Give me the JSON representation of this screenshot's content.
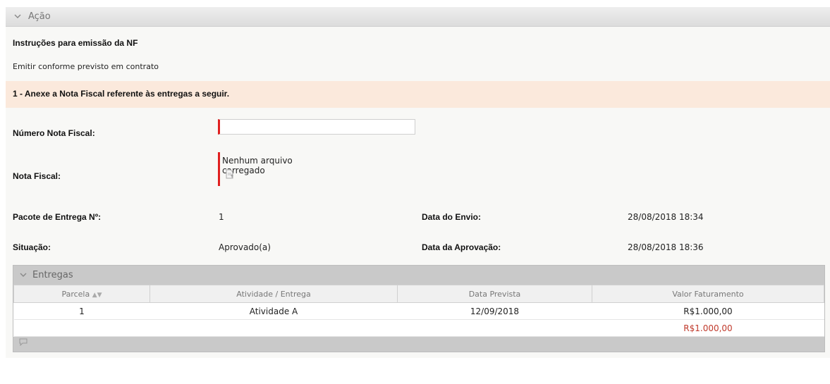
{
  "action_panel": {
    "title": "Ação"
  },
  "instructions": {
    "title": "Instruções para emissão da NF",
    "text": "Emitir conforme previsto em contrato"
  },
  "step": {
    "label": "1 - Anexe a Nota Fiscal referente às entregas a seguir."
  },
  "form": {
    "numero_label": "Número Nota Fiscal:",
    "numero_value": "",
    "nota_label": "Nota Fiscal:",
    "nota_file_status": "Nenhum arquivo carregado",
    "upload_icon": "file-upload-icon"
  },
  "info": {
    "pacote_label": "Pacote de Entrega Nº:",
    "pacote_value": "1",
    "envio_label": "Data do Envio:",
    "envio_value": "28/08/2018 18:34",
    "situacao_label": "Situação:",
    "situacao_value": "Aprovado(a)",
    "aprovacao_label": "Data da Aprovação:",
    "aprovacao_value": "28/08/2018 18:36"
  },
  "entregas": {
    "title": "Entregas",
    "columns": [
      "Parcela",
      "Atividade / Entrega",
      "Data Prevista",
      "Valor Faturamento"
    ],
    "rows": [
      {
        "parcela": "1",
        "atividade": "Atividade A",
        "data": "12/09/2018",
        "valor": "R$1.000,00"
      }
    ],
    "total": "R$1.000,00",
    "colors": {
      "total": "#c0392b",
      "required": "#e02020",
      "step_bg": "#fbe9dc"
    }
  }
}
